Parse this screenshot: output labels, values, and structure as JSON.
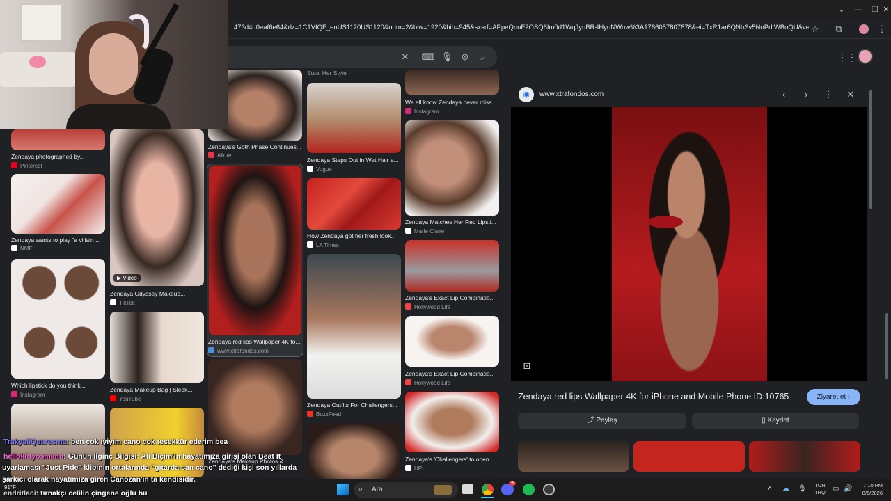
{
  "browser": {
    "url": "473d4d0eaf6e64&rlz=1C1VIQF_enUS1120US1120&udm=2&biw=1920&bih=945&sxsrf=APpeQnuF2OSQ6Im0d1WqJynBR-IHyoNWnw%3A1786057807878&ei=TxR1ar6QNbSv5NoPrLWBoQU&ved=0a...",
    "window_controls": [
      "⌄",
      "—",
      "❐",
      "✕"
    ]
  },
  "grid": {
    "col1": [
      {
        "caption": "Zendaya photographed by...",
        "source": "Pinterest",
        "fav": "#e60023"
      },
      {
        "caption": "Zendaya wants to play \"a villain ...",
        "source": "NME",
        "fav": "#ffffff"
      },
      {
        "caption": "Which lipstick do you think...",
        "source": "Instagram",
        "fav": "#d62976"
      }
    ],
    "col2": [
      {
        "caption": "Zendaya Odyssey Makeup...",
        "source": "TikTok",
        "fav": "#ffffff",
        "badge": "Video"
      },
      {
        "caption": "Zendaya Makeup Bag | Sleek...",
        "source": "YouTube",
        "fav": "#ff0000"
      }
    ],
    "col3": [
      {
        "caption": "Zendaya's Goth Phase Continues...",
        "source": "Allure",
        "fav": "#e8334a"
      },
      {
        "caption": "Zendaya red lips Wallpaper 4K fo...",
        "source": "www.xtrafondos.com",
        "fav": "#4a90d9"
      },
      {
        "caption": "Zendaya's Makeup Photos &...",
        "source": "",
        "fav": "#888888"
      }
    ],
    "col4": [
      {
        "caption": "Steal Her Style",
        "source": "",
        "fav": "#888888"
      },
      {
        "caption": "Zendaya Steps Out in Wet Hair a...",
        "source": "Vogue",
        "fav": "#ffffff"
      },
      {
        "caption": "How Zendaya got her fresh look...",
        "source": "LA Times",
        "fav": "#ffffff"
      },
      {
        "caption": "Zendaya Outfits For Challengers...",
        "source": "BuzzFeed",
        "fav": "#e32"
      }
    ],
    "col5": [
      {
        "caption": "We all know Zendaya never miss...",
        "source": "Instagram",
        "fav": "#d62976"
      },
      {
        "caption": "Zendaya Matches Her Red Lipsti...",
        "source": "Marie Claire",
        "fav": "#ffffff"
      },
      {
        "caption": "Zendaya's Exact Lip Combinatio...",
        "source": "Hollywood Life",
        "fav": "#e44"
      },
      {
        "caption": "Zendaya's Exact Lip Combinatio...",
        "source": "Hollywood Life",
        "fav": "#e44"
      },
      {
        "caption": "Zendaya's 'Challengers' to open...",
        "source": "UPI",
        "fav": "#ffffff"
      }
    ]
  },
  "panel": {
    "site": "www.xtrafondos.com",
    "title": "Zendaya red lips Wallpaper 4K for iPhone and Mobile Phone ID:10765",
    "visit_label": "Ziyaret et",
    "share_label": "Paylaş",
    "save_label": "Kaydet"
  },
  "chat": [
    {
      "user": "TrakyaliQuaresma",
      "user_color": "#7b7bff",
      "text": ": ben cok iyiyim cano cok tesekkür ederim bea"
    },
    {
      "user": "hellokittyosmann",
      "user_color": "#ff5fd2",
      "text": ": Günün İlginç Bilgisi: Ali Biçim'in hayatımıza girişi olan Beat It"
    },
    {
      "user": "",
      "user_color": "#ffffff",
      "text": "uyarlaması \"Just Pide\" klibinin ortalarında \"gitarda can cano\" dediği kişi son yıllarda"
    },
    {
      "user": "",
      "user_color": "#ffffff",
      "text": "şarkıcı olarak hayatımıza giren Canozan'ın ta kendisidir."
    },
    {
      "user": "endritlaci",
      "user_color": "#cfcfcf",
      "text": ": tırnakçı celilin çingene oğlu bu"
    }
  ],
  "taskbar": {
    "weather_temp": "91°F",
    "search_placeholder": "Ara",
    "lang_top": "TUR",
    "lang_bottom": "TRQ",
    "time": "7:10 PM",
    "date": "8/6/2026",
    "discord_badge": "9"
  }
}
